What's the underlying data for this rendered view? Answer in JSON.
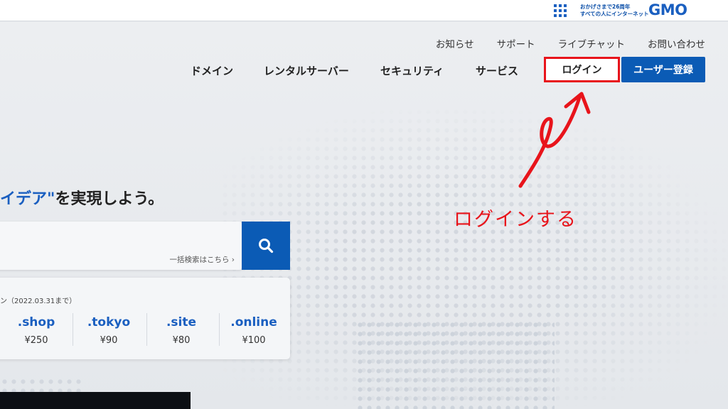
{
  "gmo_bar": {
    "tagline_line1": "おかげさまで26周年",
    "tagline_line2": "すべての人にインターネット",
    "logo": "GMO"
  },
  "util_nav": [
    "お知らせ",
    "サポート",
    "ライブチャット",
    "お問い合わせ"
  ],
  "main_nav": {
    "items": [
      "ドメイン",
      "レンタルサーバー",
      "セキュリティ",
      "サービス"
    ],
    "login": "ログイン",
    "register": "ユーザー登録"
  },
  "hero": {
    "accent": "イデア\"",
    "rest": "を実現しよう。"
  },
  "search": {
    "bulk_link": "一括検索はこちら ›",
    "icon": "search-icon"
  },
  "campaign": {
    "note": "ン（2022.03.31まで）",
    "tlds": [
      {
        "name": ".shop",
        "price": "¥250"
      },
      {
        "name": ".tokyo",
        "price": "¥90"
      },
      {
        "name": ".site",
        "price": "¥80"
      },
      {
        "name": ".online",
        "price": "¥100"
      }
    ]
  },
  "annotation": {
    "text": "ログインする",
    "color": "#e8141b"
  },
  "colors": {
    "brand_blue": "#0b5bb5",
    "accent_red": "#e8141b"
  }
}
